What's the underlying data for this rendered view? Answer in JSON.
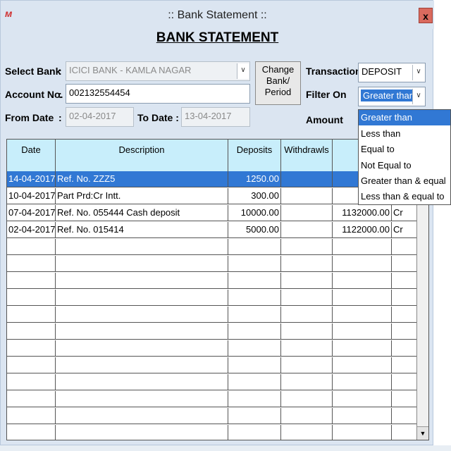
{
  "window": {
    "title": ":: Bank Statement ::",
    "close_label": "x"
  },
  "heading": "BANK STATEMENT",
  "form": {
    "select_bank_label": "Select Bank",
    "select_bank_value": "ICICI BANK - KAMLA NAGAR",
    "account_label": "Account No.",
    "account_value": "002132554454",
    "from_date_label": "From Date",
    "from_date_value": "02-04-2017",
    "to_date_label": "To Date :",
    "to_date_value": "13-04-2017",
    "change_button_line1": "Change",
    "change_button_line2": "Bank/",
    "change_button_line3": "Period",
    "transaction_label": "Transaction",
    "transaction_value": "DEPOSIT",
    "filter_label": "Filter On",
    "filter_value": "Greater than",
    "amount_label": "Amount",
    "colon": ":"
  },
  "filter_options": [
    "Greater than",
    "Less than",
    "Equal to",
    "Not Equal to",
    "Greater than & equal",
    "Less than & equal to"
  ],
  "table": {
    "headers": [
      "Date",
      "Description",
      "Deposits",
      "Withdrawls",
      "B",
      ""
    ],
    "rows": [
      {
        "date": "14-04-2017",
        "desc": "Ref. No. ZZZ5",
        "deposit": "1250.00",
        "withdrawl": "",
        "balance": "112",
        "crdr": ""
      },
      {
        "date": "10-04-2017",
        "desc": "Part Prd:Cr Intt.",
        "deposit": "300.00",
        "withdrawl": "",
        "balance": "113",
        "crdr": ""
      },
      {
        "date": "07-04-2017",
        "desc": "Ref. No. 055444 Cash deposit",
        "deposit": "10000.00",
        "withdrawl": "",
        "balance": "1132000.00",
        "crdr": "Cr"
      },
      {
        "date": "02-04-2017",
        "desc": "Ref. No. 015414",
        "deposit": "5000.00",
        "withdrawl": "",
        "balance": "1122000.00",
        "crdr": "Cr"
      }
    ]
  },
  "colors": {
    "window_bg": "#dbe5f1",
    "header_bg": "#c8eefb",
    "selection": "#3178d4"
  },
  "icons": {
    "app": "app-logo-icon",
    "close": "close-icon",
    "dropdown": "chevron-down-icon",
    "scroll_down": "scroll-down-icon"
  }
}
